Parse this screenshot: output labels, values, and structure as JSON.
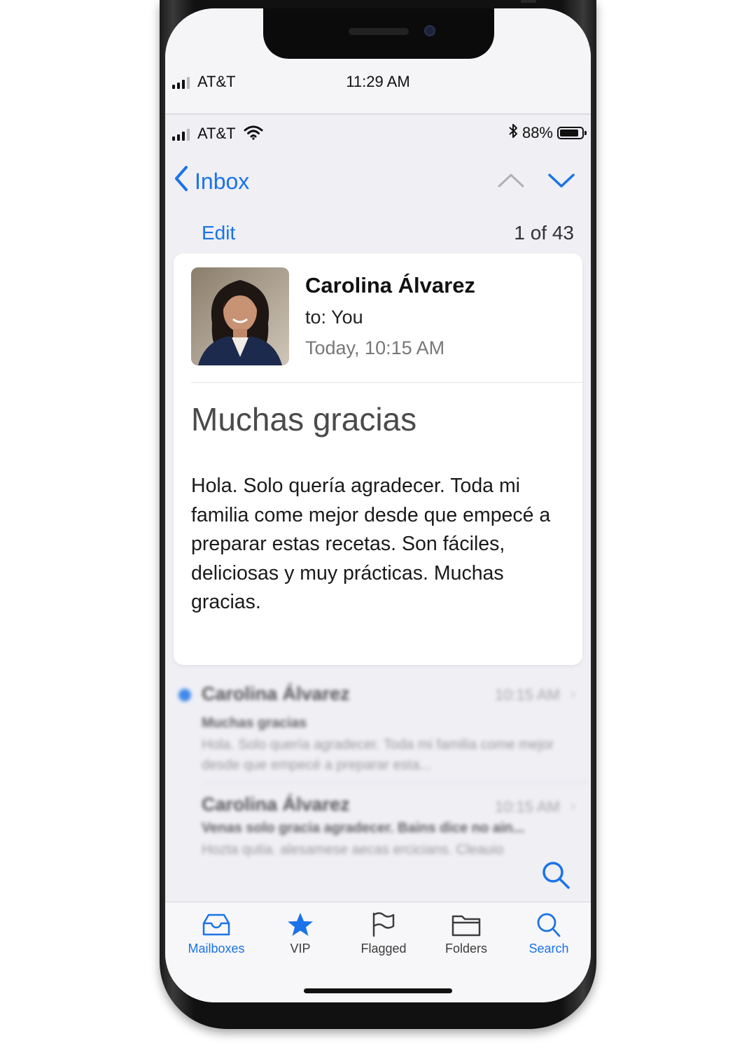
{
  "status_bar_top": {
    "carrier": "AT&T",
    "time": "11:29 AM"
  },
  "status_bar": {
    "carrier": "AT&T",
    "battery": "88%",
    "battery_level": 0.88
  },
  "nav": {
    "back_label": "Inbox",
    "edit_label": "Edit",
    "count": "1 of 43"
  },
  "message": {
    "sender": "Carolina Álvarez",
    "recipient": "to: You",
    "date": "Today, 10:15 AM",
    "subject": "Muchas gracias",
    "body": "Hola. Solo quería agradecer. Toda mi familia come mejor desde que empecé a preparar estas recetas. Son fáciles, deliciosas y muy prácticas. Muchas gracias."
  },
  "list": [
    {
      "sender": "Carolina Álvarez",
      "time": "10:15 AM",
      "subject": "Muchas gracias",
      "preview": "Hola. Solo quería agradecer. Toda mi familia come mejor desde que empecé a preparar esta...",
      "unread": true
    },
    {
      "sender": "Carolina Álvarez",
      "time": "10:15 AM",
      "subject": "Venas solo gracia agradecer. Bains dice no ain...",
      "preview": "Hozta qutia. alesamese aecas ercicians. Cleauio",
      "unread": false
    }
  ],
  "tabs": [
    {
      "label": "Mailboxes",
      "icon": "inbox-tray-icon"
    },
    {
      "label": "VIP",
      "icon": "star-icon"
    },
    {
      "label": "Flagged",
      "icon": "flag-icon"
    },
    {
      "label": "Folders",
      "icon": "folder-icon"
    },
    {
      "label": "Search",
      "icon": "search-icon"
    }
  ],
  "colors": {
    "accent": "#1a73e8",
    "background": "#efeff4",
    "card": "#ffffff"
  }
}
